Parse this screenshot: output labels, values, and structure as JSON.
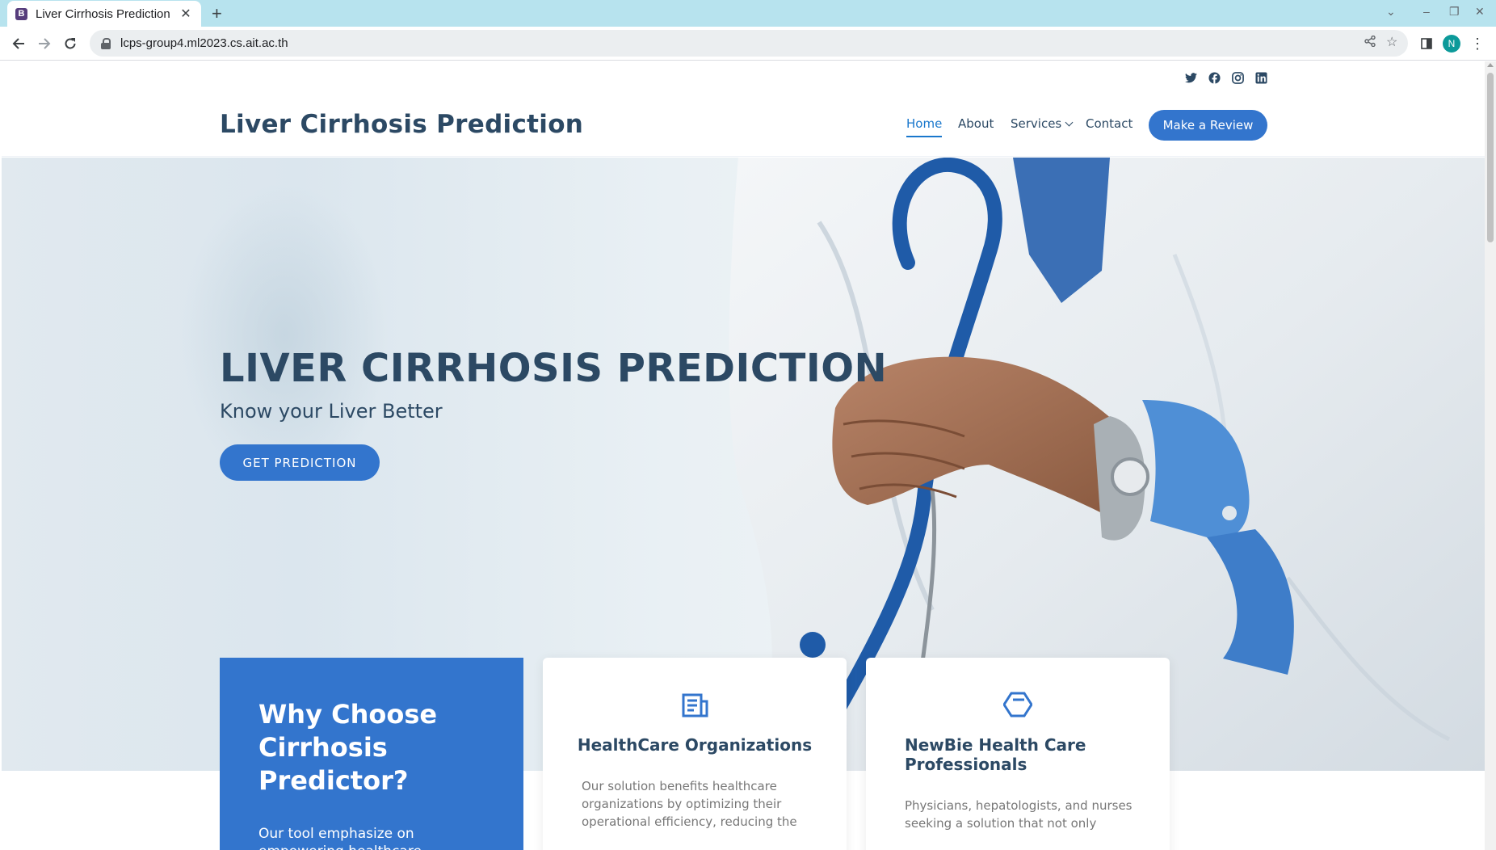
{
  "browser": {
    "tab_title": "Liver Cirrhosis Prediction",
    "favicon_letter": "B",
    "url": "lcps-group4.ml2023.cs.ait.ac.th",
    "profile_initial": "N"
  },
  "social": [
    "twitter-icon",
    "facebook-icon",
    "instagram-icon",
    "linkedin-icon"
  ],
  "header": {
    "logo": "Liver Cirrhosis Prediction",
    "nav": {
      "home": "Home",
      "about": "About",
      "services": "Services",
      "contact": "Contact"
    },
    "cta": "Make a Review"
  },
  "hero": {
    "title": "LIVER CIRRHOSIS PREDICTION",
    "subtitle": "Know your Liver Better",
    "button": "GET PREDICTION"
  },
  "why": {
    "title": "Why Choose Cirrhosis Predictor?",
    "text": "Our tool emphasize on empowering healthcare professionals, especially"
  },
  "cards": [
    {
      "icon": "document-icon",
      "title": "HealthCare Organizations",
      "text": "Our solution benefits healthcare organizations by optimizing their operational efficiency, reducing the"
    },
    {
      "icon": "hexagon-icon",
      "title": "NewBie Health Care Professionals",
      "text": "Physicians, hepatologists, and nurses seeking a solution that not only"
    }
  ],
  "colors": {
    "primary": "#3375cd",
    "heading": "#2c4964",
    "tabstrip": "#b7e3ee"
  }
}
